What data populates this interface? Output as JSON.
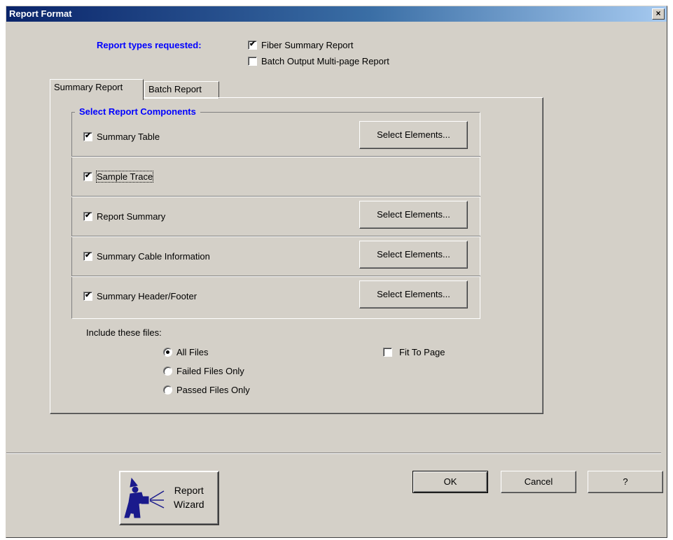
{
  "window": {
    "title": "Report Format",
    "close_label": "×"
  },
  "report_types": {
    "label": "Report types requested:",
    "options": [
      {
        "label": "Fiber Summary Report",
        "checked": true
      },
      {
        "label": "Batch Output Multi-page Report",
        "checked": false
      }
    ]
  },
  "tabs": [
    {
      "label": "Summary Report",
      "active": true
    },
    {
      "label": "Batch Report",
      "active": false
    }
  ],
  "components": {
    "title": "Select Report Components",
    "rows": [
      {
        "label": "Summary Table",
        "checked": true,
        "button": "Select Elements..."
      },
      {
        "label": "Sample Trace",
        "checked": true,
        "button": null
      },
      {
        "label": "Report Summary",
        "checked": true,
        "button": "Select Elements..."
      },
      {
        "label": "Summary Cable Information",
        "checked": true,
        "button": "Select Elements..."
      },
      {
        "label": "Summary Header/Footer",
        "checked": true,
        "button": "Select Elements..."
      }
    ]
  },
  "include_files": {
    "label": "Include these files:",
    "options": [
      {
        "label": "All Files",
        "selected": true
      },
      {
        "label": "Failed Files Only",
        "selected": false
      },
      {
        "label": "Passed Files Only",
        "selected": false
      }
    ]
  },
  "fit_to_page": {
    "label": "Fit To Page",
    "checked": false
  },
  "buttons": {
    "ok": "OK",
    "cancel": "Cancel",
    "help": "?"
  },
  "wizard": {
    "line1": "Report",
    "line2": "Wizard"
  },
  "colors": {
    "accent_blue": "#0000ff",
    "title_gradient_start": "#0a246a",
    "face": "#d4d0c8"
  }
}
